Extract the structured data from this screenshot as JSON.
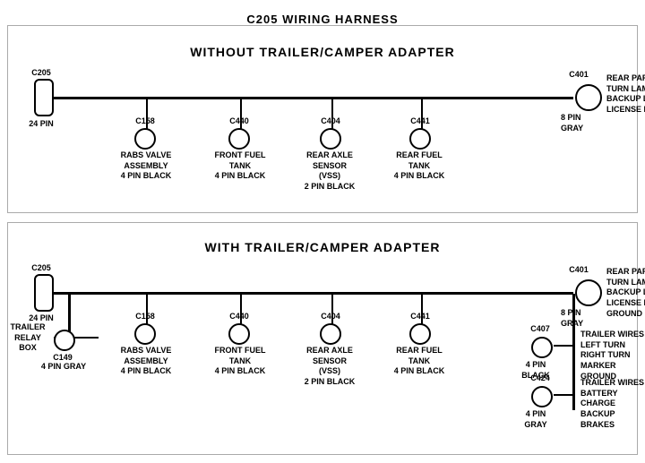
{
  "title": "C205 WIRING HARNESS",
  "top_section": {
    "label": "WITHOUT  TRAILER/CAMPER  ADAPTER",
    "left_connector": {
      "id": "C205",
      "pin": "24 PIN"
    },
    "right_connector": {
      "id": "C401",
      "pin": "8 PIN",
      "color": "GRAY",
      "desc": "REAR PARK/STOP\nTURN LAMPS\nBACKUP LAMPS\nLICENSE LAMPS"
    },
    "connectors": [
      {
        "id": "C158",
        "desc": "RABS VALVE\nASSEMBLY\n4 PIN BLACK"
      },
      {
        "id": "C440",
        "desc": "FRONT FUEL\nTANK\n4 PIN BLACK"
      },
      {
        "id": "C404",
        "desc": "REAR AXLE\nSENSOR\n(VSS)\n2 PIN BLACK"
      },
      {
        "id": "C441",
        "desc": "REAR FUEL\nTANK\n4 PIN BLACK"
      }
    ]
  },
  "bottom_section": {
    "label": "WITH  TRAILER/CAMPER  ADAPTER",
    "left_connector": {
      "id": "C205",
      "pin": "24 PIN"
    },
    "extra_connector": {
      "id": "C149",
      "desc": "TRAILER\nRELAY\nBOX",
      "pin": "4 PIN GRAY"
    },
    "right_connector": {
      "id": "C401",
      "pin": "8 PIN",
      "color": "GRAY",
      "desc": "REAR PARK/STOP\nTURN LAMPS\nBACKUP LAMPS\nLICENSE LAMPS\nGROUND"
    },
    "connectors": [
      {
        "id": "C158",
        "desc": "RABS VALVE\nASSEMBLY\n4 PIN BLACK"
      },
      {
        "id": "C440",
        "desc": "FRONT FUEL\nTANK\n4 PIN BLACK"
      },
      {
        "id": "C404",
        "desc": "REAR AXLE\nSENSOR\n(VSS)\n2 PIN BLACK"
      },
      {
        "id": "C441",
        "desc": "REAR FUEL\nTANK\n4 PIN BLACK"
      }
    ],
    "right_extras": [
      {
        "id": "C407",
        "pin": "4 PIN\nBLACK",
        "desc": "TRAILER WIRES\nLEFT TURN\nRIGHT TURN\nMARKER\nGROUND"
      },
      {
        "id": "C424",
        "pin": "4 PIN\nGRAY",
        "desc": "TRAILER WIRES\nBATTERY CHARGE\nBACKUP\nBRAKES"
      }
    ]
  }
}
